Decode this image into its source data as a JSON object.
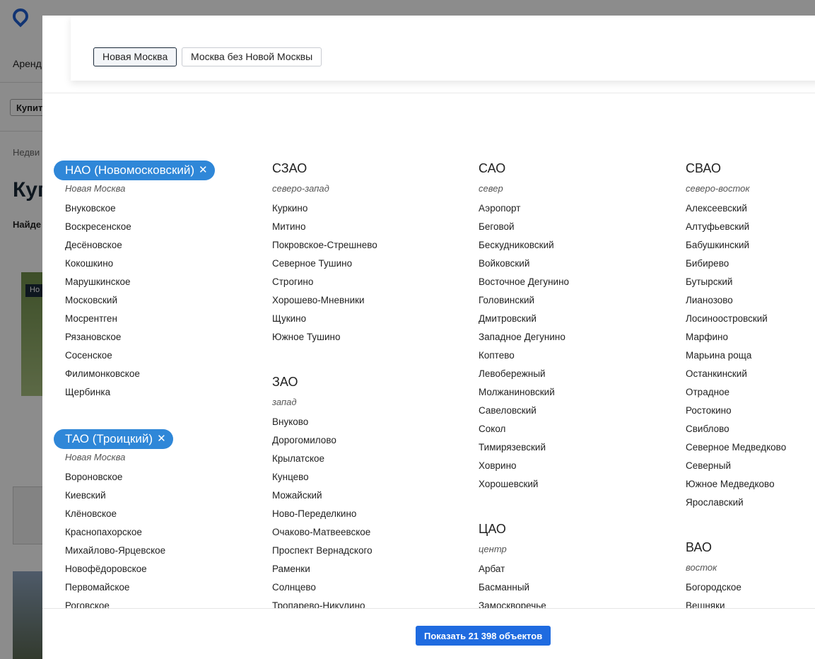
{
  "background": {
    "nav_label": "Аренд",
    "buy_label": "Купит",
    "breadcrumb": "Недви",
    "heading": "Куп",
    "found": "Найде",
    "badge": "Но"
  },
  "toggles": [
    {
      "label": "Новая Москва",
      "active": true
    },
    {
      "label": "Москва без Новой Москвы",
      "active": false
    }
  ],
  "columns": [
    [
      {
        "title": "НАО (Новомосковский)",
        "subtitle": "Новая Москва",
        "selected": true,
        "items": [
          "Внуковское",
          "Воскресенское",
          "Десёновское",
          "Кокошкино",
          "Марушкинское",
          "Московский",
          "Мосрентген",
          "Рязановское",
          "Сосенское",
          "Филимонковское",
          "Щербинка"
        ]
      },
      {
        "title": "ТАО (Троицкий)",
        "subtitle": "Новая Москва",
        "selected": true,
        "items": [
          "Вороновское",
          "Киевский",
          "Клёновское",
          "Краснопахорское",
          "Михайлово-Ярцевское",
          "Новофёдоровское",
          "Первомайское",
          "Роговское"
        ]
      }
    ],
    [
      {
        "title": "СЗАО",
        "subtitle": "северо-запад",
        "selected": false,
        "items": [
          "Куркино",
          "Митино",
          "Покровское-Стрешнево",
          "Северное Тушино",
          "Строгино",
          "Хорошево-Мневники",
          "Щукино",
          "Южное Тушино"
        ]
      },
      {
        "title": "ЗАО",
        "subtitle": "запад",
        "selected": false,
        "items": [
          "Внуково",
          "Дорогомилово",
          "Крылатское",
          "Кунцево",
          "Можайский",
          "Ново-Переделкино",
          "Очаково-Матвеевское",
          "Проспект Вернадского",
          "Раменки",
          "Солнцево",
          "Тропарево-Никулино"
        ]
      }
    ],
    [
      {
        "title": "САО",
        "subtitle": "север",
        "selected": false,
        "items": [
          "Аэропорт",
          "Беговой",
          "Бескудниковский",
          "Войковский",
          "Восточное Дегунино",
          "Головинский",
          "Дмитровский",
          "Западное Дегунино",
          "Коптево",
          "Левобережный",
          "Молжаниновский",
          "Савеловский",
          "Сокол",
          "Тимирязевский",
          "Ховрино",
          "Хорошевский"
        ]
      },
      {
        "title": "ЦАО",
        "subtitle": "центр",
        "selected": false,
        "items": [
          "Арбат",
          "Басманный",
          "Замоскворечье"
        ]
      }
    ],
    [
      {
        "title": "СВАО",
        "subtitle": "северо-восток",
        "selected": false,
        "items": [
          "Алексеевский",
          "Алтуфьевский",
          "Бабушкинский",
          "Бибирево",
          "Бутырский",
          "Лианозово",
          "Лосиноостровский",
          "Марфино",
          "Марьина роща",
          "Останкинский",
          "Отрадное",
          "Ростокино",
          "Свиблово",
          "Северное Медведково",
          "Северный",
          "Южное Медведково",
          "Ярославский"
        ]
      },
      {
        "title": "ВАО",
        "subtitle": "восток",
        "selected": false,
        "items": [
          "Богородское",
          "Вешняки"
        ]
      }
    ]
  ],
  "submit": {
    "label": "Показать 21 398 объектов"
  },
  "colors": {
    "chip": "#2f87d8",
    "button": "#1f6be0",
    "logo": "#1f5fd1"
  }
}
